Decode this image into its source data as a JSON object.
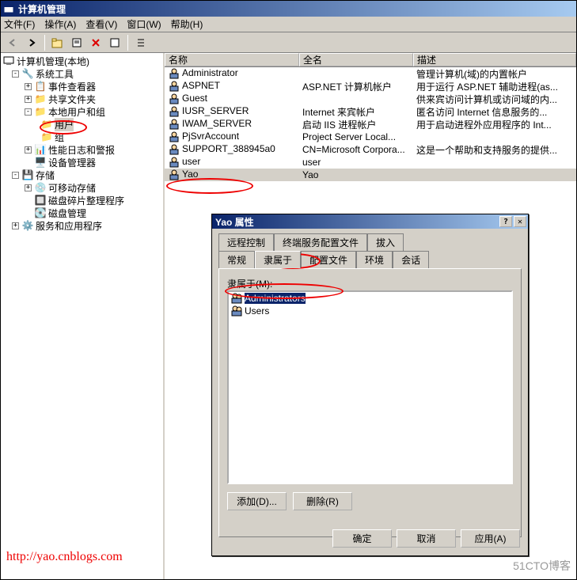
{
  "window": {
    "title": "计算机管理"
  },
  "menu": {
    "file": "文件(F)",
    "action": "操作(A)",
    "view": "查看(V)",
    "window": "窗口(W)",
    "help": "帮助(H)"
  },
  "tree": {
    "root": "计算机管理(本地)",
    "sys_tools": "系统工具",
    "event_viewer": "事件查看器",
    "shared": "共享文件夹",
    "local_users": "本地用户和组",
    "users": "用户",
    "groups": "组",
    "perf": "性能日志和警报",
    "devmgr": "设备管理器",
    "storage": "存储",
    "removable": "可移动存储",
    "defrag": "磁盘碎片整理程序",
    "diskmgmt": "磁盘管理",
    "services": "服务和应用程序"
  },
  "columns": {
    "name": "名称",
    "fullname": "全名",
    "desc": "描述"
  },
  "users": [
    {
      "name": "Administrator",
      "fullname": "",
      "desc": "管理计算机(域)的内置帐户"
    },
    {
      "name": "ASPNET",
      "fullname": "ASP.NET 计算机帐户",
      "desc": "用于运行 ASP.NET 辅助进程(as..."
    },
    {
      "name": "Guest",
      "fullname": "",
      "desc": "供来宾访问计算机或访问域的内..."
    },
    {
      "name": "IUSR_SERVER",
      "fullname": "Internet 来宾帐户",
      "desc": "匿名访问 Internet 信息服务的..."
    },
    {
      "name": "IWAM_SERVER",
      "fullname": "启动 IIS 进程帐户",
      "desc": "用于启动进程外应用程序的 Int..."
    },
    {
      "name": "PjSvrAccount",
      "fullname": "Project Server Local...",
      "desc": ""
    },
    {
      "name": "SUPPORT_388945a0",
      "fullname": "CN=Microsoft Corpora...",
      "desc": "这是一个帮助和支持服务的提供..."
    },
    {
      "name": "user",
      "fullname": "user",
      "desc": ""
    },
    {
      "name": "Yao",
      "fullname": "Yao",
      "desc": ""
    }
  ],
  "dialog": {
    "title": "Yao 属性",
    "tabs_back": [
      "远程控制",
      "终端服务配置文件",
      "拔入"
    ],
    "tabs_front": [
      "常规",
      "隶属于",
      "配置文件",
      "环境",
      "会话"
    ],
    "active_tab": "隶属于",
    "memberof_label": "隶属于(M):",
    "groups": [
      "Administrators",
      "Users"
    ],
    "add": "添加(D)...",
    "remove": "删除(R)",
    "ok": "确定",
    "cancel": "取消",
    "apply": "应用(A)"
  },
  "watermark": {
    "url": "http://yao.cnblogs.com",
    "credit": "51CTO博客"
  }
}
